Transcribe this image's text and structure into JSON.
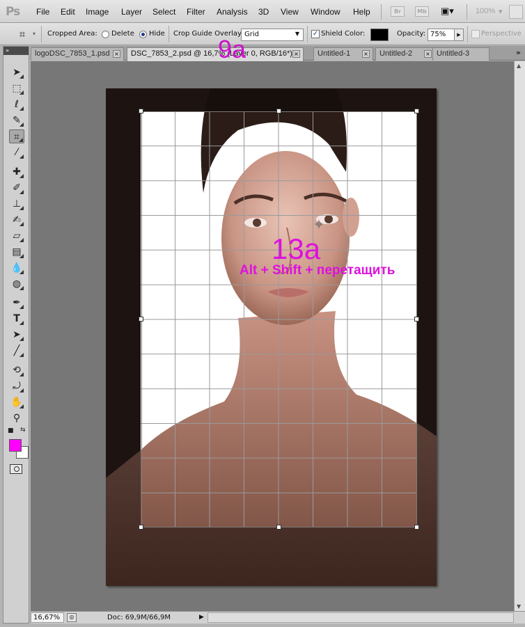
{
  "app": {
    "logo": "Ps"
  },
  "menu": [
    "File",
    "Edit",
    "Image",
    "Layer",
    "Select",
    "Filter",
    "Analysis",
    "3D",
    "View",
    "Window",
    "Help"
  ],
  "appbar": {
    "bridge": "Br",
    "minibridge": "Mb",
    "screen_mode": "▣▾",
    "zoom": "100%",
    "zoom_arrow": "▾"
  },
  "options": {
    "cropped_area_label": "Cropped Area:",
    "delete_label": "Delete",
    "hide_label": "Hide",
    "hide_selected": true,
    "overlay_label": "Crop Guide Overlay:",
    "overlay_value": "Grid",
    "shield_label": "Shield",
    "shield_checked": true,
    "color_label": "Color:",
    "shield_color": "#000000",
    "opacity_label": "Opacity:",
    "opacity_value": "75%",
    "perspective_label": "Perspective",
    "perspective_checked": false
  },
  "tabs": [
    {
      "label": "logoDSC_7853_1.psd",
      "active": false
    },
    {
      "label": "DSC_7853_2.psd @ 16,7% (Layer 0, RGB/16*) *",
      "active": true
    },
    {
      "label": "Untitled-1",
      "active": false
    },
    {
      "label": "Untitled-2",
      "active": false
    },
    {
      "label": "Untitled-3",
      "active": false
    }
  ],
  "tabs_overflow": "»",
  "toolbar": {
    "grip": "»",
    "foreground_color": "#ff00ff",
    "background_color": "#ffffff"
  },
  "annotations": {
    "step_9a": "9a",
    "step_13a": "13a",
    "hint_13a": "Alt + Shift + перетащить"
  },
  "status": {
    "zoom": "16,67%",
    "doc_info": "Doc: 69,9M/66,9M"
  }
}
